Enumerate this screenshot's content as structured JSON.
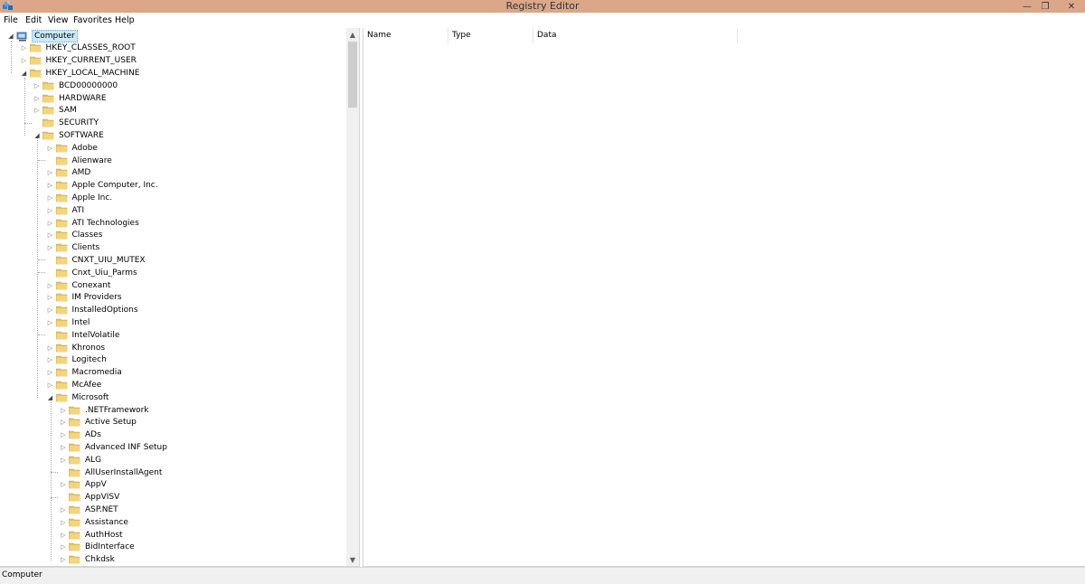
{
  "window": {
    "title": "Registry Editor",
    "minimize_glyph": "—",
    "restore_glyph": "❐",
    "close_glyph": "✕"
  },
  "menu": [
    "File",
    "Edit",
    "View",
    "Favorites",
    "Help"
  ],
  "tree": [
    {
      "label": "Computer",
      "depth": 0,
      "state": "expanded",
      "selected": true,
      "icon": "computer-icon"
    },
    {
      "label": "HKEY_CLASSES_ROOT",
      "depth": 1,
      "state": "collapsed"
    },
    {
      "label": "HKEY_CURRENT_USER",
      "depth": 1,
      "state": "collapsed"
    },
    {
      "label": "HKEY_LOCAL_MACHINE",
      "depth": 1,
      "state": "expanded"
    },
    {
      "label": "BCD00000000",
      "depth": 2,
      "state": "collapsed"
    },
    {
      "label": "HARDWARE",
      "depth": 2,
      "state": "collapsed"
    },
    {
      "label": "SAM",
      "depth": 2,
      "state": "collapsed"
    },
    {
      "label": "SECURITY",
      "depth": 2,
      "state": "leaf"
    },
    {
      "label": "SOFTWARE",
      "depth": 2,
      "state": "expanded"
    },
    {
      "label": "Adobe",
      "depth": 3,
      "state": "collapsed"
    },
    {
      "label": "Alienware",
      "depth": 3,
      "state": "leaf"
    },
    {
      "label": "AMD",
      "depth": 3,
      "state": "collapsed"
    },
    {
      "label": "Apple Computer, Inc.",
      "depth": 3,
      "state": "collapsed"
    },
    {
      "label": "Apple Inc.",
      "depth": 3,
      "state": "collapsed"
    },
    {
      "label": "ATI",
      "depth": 3,
      "state": "collapsed"
    },
    {
      "label": "ATI Technologies",
      "depth": 3,
      "state": "collapsed"
    },
    {
      "label": "Classes",
      "depth": 3,
      "state": "collapsed"
    },
    {
      "label": "Clients",
      "depth": 3,
      "state": "collapsed"
    },
    {
      "label": "CNXT_UIU_MUTEX",
      "depth": 3,
      "state": "leaf"
    },
    {
      "label": "Cnxt_Uiu_Parms",
      "depth": 3,
      "state": "leaf"
    },
    {
      "label": "Conexant",
      "depth": 3,
      "state": "collapsed"
    },
    {
      "label": "IM Providers",
      "depth": 3,
      "state": "collapsed"
    },
    {
      "label": "InstalledOptions",
      "depth": 3,
      "state": "collapsed"
    },
    {
      "label": "Intel",
      "depth": 3,
      "state": "collapsed"
    },
    {
      "label": "IntelVolatile",
      "depth": 3,
      "state": "leaf"
    },
    {
      "label": "Khronos",
      "depth": 3,
      "state": "collapsed"
    },
    {
      "label": "Logitech",
      "depth": 3,
      "state": "collapsed"
    },
    {
      "label": "Macromedia",
      "depth": 3,
      "state": "collapsed"
    },
    {
      "label": "McAfee",
      "depth": 3,
      "state": "collapsed"
    },
    {
      "label": "Microsoft",
      "depth": 3,
      "state": "expanded"
    },
    {
      "label": ".NETFramework",
      "depth": 4,
      "state": "collapsed"
    },
    {
      "label": "Active Setup",
      "depth": 4,
      "state": "collapsed"
    },
    {
      "label": "ADs",
      "depth": 4,
      "state": "collapsed"
    },
    {
      "label": "Advanced INF Setup",
      "depth": 4,
      "state": "collapsed"
    },
    {
      "label": "ALG",
      "depth": 4,
      "state": "collapsed"
    },
    {
      "label": "AllUserInstallAgent",
      "depth": 4,
      "state": "leaf"
    },
    {
      "label": "AppV",
      "depth": 4,
      "state": "collapsed"
    },
    {
      "label": "AppVISV",
      "depth": 4,
      "state": "leaf"
    },
    {
      "label": "ASP.NET",
      "depth": 4,
      "state": "collapsed"
    },
    {
      "label": "Assistance",
      "depth": 4,
      "state": "collapsed"
    },
    {
      "label": "AuthHost",
      "depth": 4,
      "state": "collapsed"
    },
    {
      "label": "BidInterface",
      "depth": 4,
      "state": "collapsed"
    },
    {
      "label": "Chkdsk",
      "depth": 4,
      "state": "collapsed"
    }
  ],
  "list": {
    "columns": [
      "Name",
      "Type",
      "Data"
    ]
  },
  "status": {
    "path": "Computer"
  },
  "colors": {
    "titlebar": "#dba788",
    "selection": "#cce8ff",
    "folder": "#e8c15a"
  }
}
